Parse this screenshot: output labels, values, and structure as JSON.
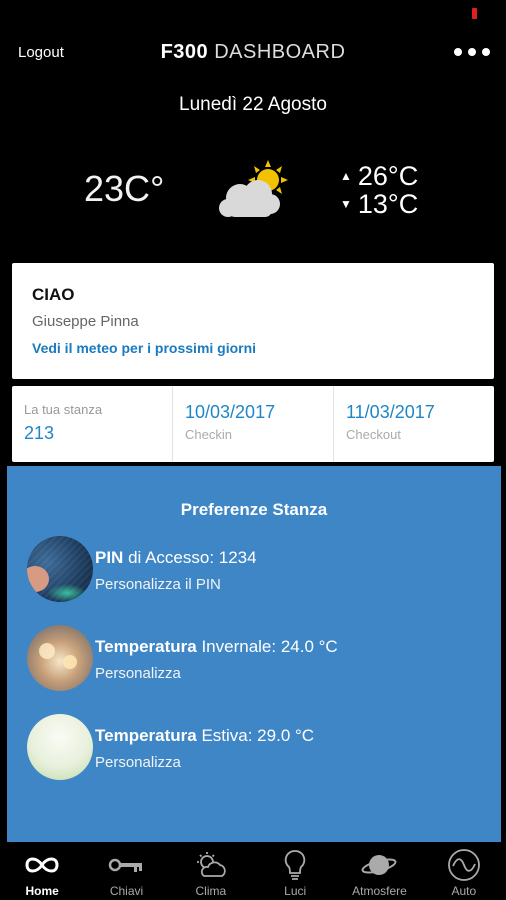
{
  "app": {
    "title_bold": "F300",
    "title_light": "DASHBOARD"
  },
  "header": {
    "logout_label": "Logout",
    "more_icon": "more-horizontal-icon"
  },
  "date": "Lunedì 22 Agosto",
  "weather": {
    "current_temp": "23C°",
    "icon": "partly-cloudy-icon",
    "max_temp": "26°C",
    "min_temp": "13°C"
  },
  "greeting": {
    "title": "CIAO",
    "name": "Giuseppe Pinna",
    "forecast_link": "Vedi il meteo per i prossimi giorni"
  },
  "stay": {
    "room_label": "La tua stanza",
    "room_value": "213",
    "checkin_value": "10/03/2017",
    "checkin_label": "Checkin",
    "checkout_value": "11/03/2017",
    "checkout_label": "Checkout"
  },
  "preferences": {
    "title": "Preferenze Stanza",
    "items": [
      {
        "bold": "PIN",
        "rest": " di Accesso: 1234",
        "sub": "Personalizza il PIN"
      },
      {
        "bold": "Temperatura",
        "rest": " Invernale: 24.0 °C",
        "sub": "Personalizza"
      },
      {
        "bold": "Temperatura",
        "rest": " Estiva: 29.0 °C",
        "sub": "Personalizza"
      }
    ]
  },
  "tabs": [
    {
      "label": "Home",
      "icon": "infinity-icon",
      "active": true
    },
    {
      "label": "Chiavi",
      "icon": "key-icon",
      "active": false
    },
    {
      "label": "Clima",
      "icon": "climate-icon",
      "active": false
    },
    {
      "label": "Luci",
      "icon": "lightbulb-icon",
      "active": false
    },
    {
      "label": "Atmosfere",
      "icon": "planet-icon",
      "active": false
    },
    {
      "label": "Auto",
      "icon": "auto-wave-icon",
      "active": false
    }
  ],
  "colors": {
    "accent": "#3f86c6",
    "link": "#1a7bbf",
    "value": "#1f86c7",
    "indicator": "#e02020"
  }
}
